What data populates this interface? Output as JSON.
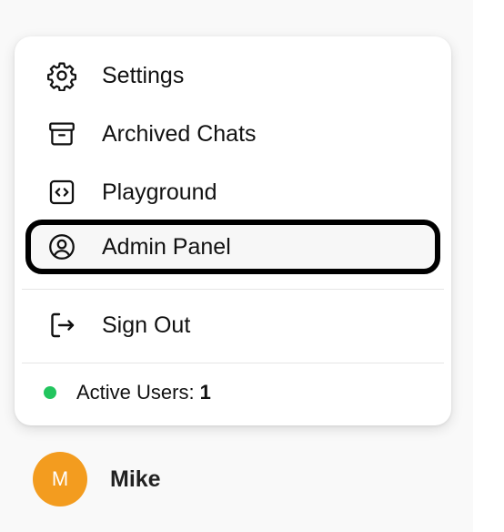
{
  "menu": {
    "items": [
      {
        "label": "Settings",
        "icon": "gear-icon"
      },
      {
        "label": "Archived Chats",
        "icon": "archive-icon"
      },
      {
        "label": "Playground",
        "icon": "code-icon"
      },
      {
        "label": "Admin Panel",
        "icon": "user-circle-icon"
      }
    ],
    "sign_out": {
      "label": "Sign Out",
      "icon": "sign-out-icon"
    },
    "status": {
      "label": "Active Users:",
      "count": "1",
      "dot_color": "#22c55e"
    }
  },
  "user": {
    "name": "Mike",
    "avatar_initial": "M",
    "avatar_color": "#f39c1f"
  }
}
